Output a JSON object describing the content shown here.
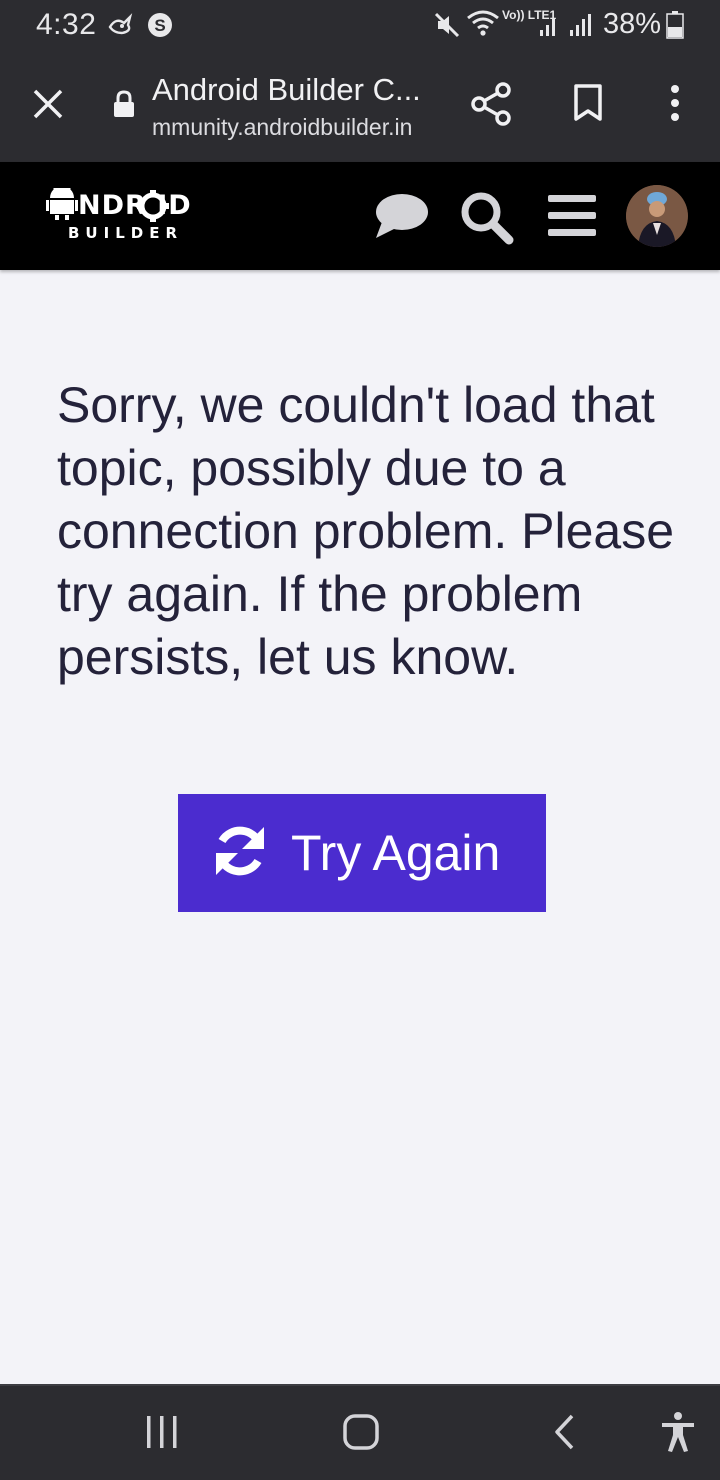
{
  "status_bar": {
    "time": "4:32",
    "network_label": "Vo)) LTE1",
    "battery": "38%",
    "icons": [
      "bird-icon",
      "s-circle-icon",
      "mute-icon",
      "wifi-icon",
      "signal-icon",
      "signal-icon",
      "battery-icon"
    ]
  },
  "browser": {
    "title": "Android Builder C...",
    "url": "mmunity.androidbuilder.in",
    "icons": [
      "close-icon",
      "lock-icon",
      "share-icon",
      "bookmark-icon",
      "more-vert-icon"
    ]
  },
  "site_header": {
    "logo_top": "NDR   ID",
    "logo_bottom": "BUILDER",
    "icons": [
      "chat-icon",
      "search-icon",
      "hamburger-menu-icon",
      "avatar"
    ]
  },
  "main": {
    "error_message": "Sorry, we couldn't load that topic, possibly due to a connection problem. Please try again. If the problem persists, let us know.",
    "retry_label": "Try Again",
    "retry_icon": "refresh-icon"
  },
  "nav": {
    "icons": [
      "recent-apps-icon",
      "home-icon",
      "back-icon",
      "accessibility-icon"
    ]
  },
  "colors": {
    "status_bg": "#2c2c30",
    "header_bg": "#000000",
    "page_bg": "#f3f3f8",
    "text": "#24223a",
    "accent": "#4b2ccf"
  }
}
